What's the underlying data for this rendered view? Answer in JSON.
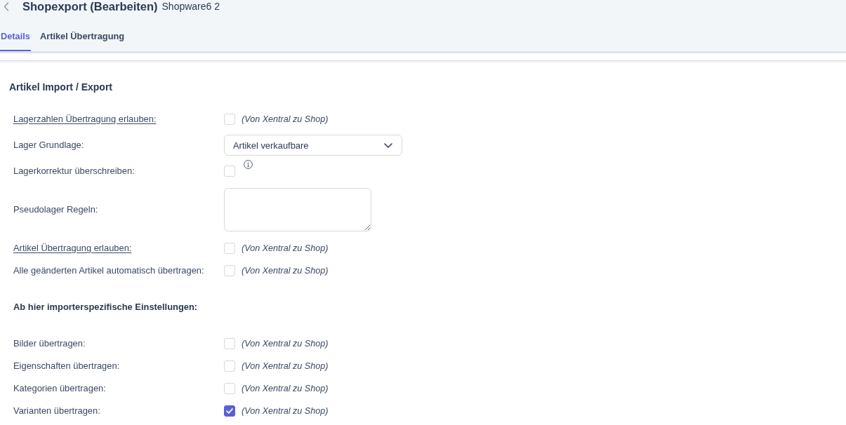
{
  "header": {
    "title": "Shopexport (Bearbeiten)",
    "subtitle": "Shopware6 2"
  },
  "tabs": [
    {
      "label": "Details",
      "selected": true
    },
    {
      "label": "Artikel Übertragung",
      "selected": false
    }
  ],
  "section": {
    "title": "Artikel Import / Export",
    "rows": [
      {
        "kind": "checkbox",
        "label": "Lagerzahlen Übertragung erlauben:",
        "underlined": true,
        "checked": false,
        "note": "(Von Xentral zu Shop)"
      },
      {
        "kind": "select",
        "label": "Lager Grundlage:",
        "underlined": false,
        "value": "Artikel verkaufbare"
      },
      {
        "kind": "checkbox",
        "label": "Lagerkorrektur überschreiben:",
        "underlined": false,
        "checked": false,
        "info": true
      },
      {
        "kind": "textarea",
        "label": "Pseudolager Regeln:",
        "underlined": false
      },
      {
        "kind": "checkbox",
        "label": "Artikel Übertragung erlauben:",
        "underlined": true,
        "checked": false,
        "note": "(Von Xentral zu Shop)"
      },
      {
        "kind": "checkbox",
        "label": "Alle geänderten Artikel automatisch übertragen:",
        "underlined": false,
        "checked": false,
        "note": "(Von Xentral zu Shop)"
      },
      {
        "kind": "heading",
        "label": "Ab hier importerspezifische Einstellungen:"
      },
      {
        "kind": "checkbox",
        "label": "Bilder übertragen:",
        "underlined": false,
        "checked": false,
        "note": "(Von Xentral zu Shop)"
      },
      {
        "kind": "checkbox",
        "label": "Eigenschaften übertragen:",
        "underlined": false,
        "checked": false,
        "note": "(Von Xentral zu Shop)"
      },
      {
        "kind": "checkbox",
        "label": "Kategorien übertragen:",
        "underlined": false,
        "checked": false,
        "note": "(Von Xentral zu Shop)"
      },
      {
        "kind": "checkbox",
        "label": "Varianten übertragen:",
        "underlined": false,
        "checked": true,
        "note": "(Von Xentral zu Shop)"
      }
    ]
  }
}
